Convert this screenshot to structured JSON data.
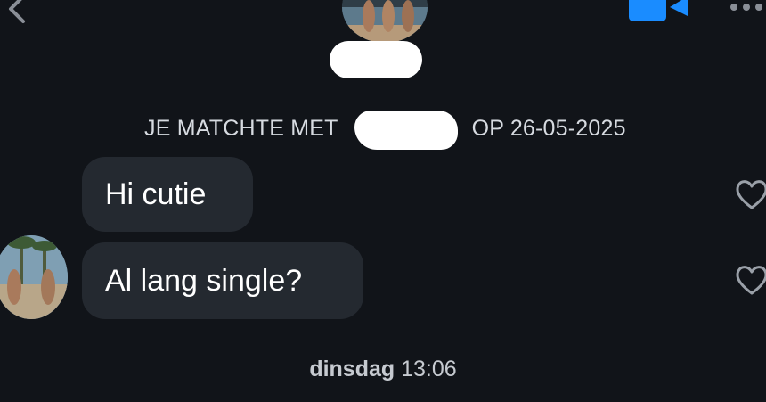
{
  "header": {
    "back_icon": "chevron-left-icon",
    "avatar": "match-avatar",
    "video_icon": "video-camera-icon",
    "more_icon": "more-dots-icon",
    "accent": "#1a8cff"
  },
  "match_banner": {
    "prefix": "JE MATCHTE MET",
    "suffix": "OP 26-05-2025"
  },
  "messages": [
    {
      "text": "Hi cutie",
      "like_icon": "heart-outline-icon"
    },
    {
      "text": "Al lang single?",
      "like_icon": "heart-outline-icon"
    }
  ],
  "timestamp": {
    "day": "dinsdag",
    "time": "13:06"
  },
  "colors": {
    "background": "#111419",
    "bubble": "#242930",
    "redaction": "#ffffff"
  }
}
